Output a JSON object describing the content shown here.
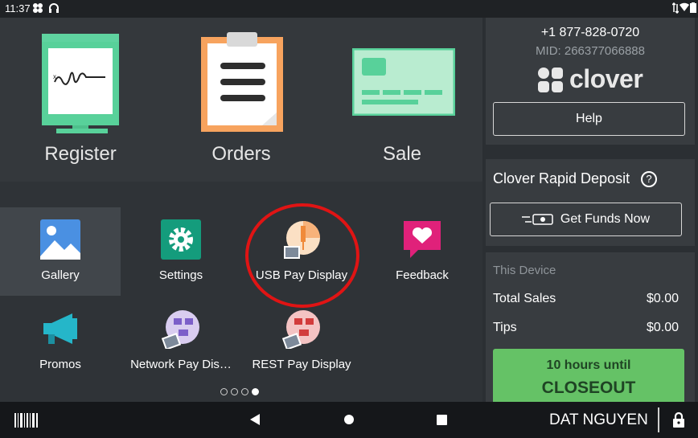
{
  "status_bar": {
    "time": "11:37",
    "icons": [
      "notification-icon",
      "headset-icon",
      "data-arrows-icon",
      "wifi-icon",
      "battery-icon"
    ]
  },
  "hero_tiles": [
    {
      "label": "Register",
      "icon": "register-icon"
    },
    {
      "label": "Orders",
      "icon": "clipboard-icon"
    },
    {
      "label": "Sale",
      "icon": "card-icon"
    }
  ],
  "apps": [
    {
      "label": "Gallery",
      "icon": "gallery-icon"
    },
    {
      "label": "Settings",
      "icon": "gear-icon"
    },
    {
      "label": "USB Pay Display",
      "icon": "usb-pay-display-icon"
    },
    {
      "label": "Feedback",
      "icon": "feedback-icon"
    },
    {
      "label": "Promos",
      "icon": "megaphone-icon"
    },
    {
      "label": "Network Pay Dis…",
      "icon": "network-pay-display-icon"
    },
    {
      "label": "REST Pay Display",
      "icon": "rest-pay-display-icon"
    }
  ],
  "pager": {
    "pages": 4,
    "current": 4
  },
  "account": {
    "phone": "+1 877-828-0720",
    "mid": "MID: 266377066888",
    "brand": "clover",
    "help_label": "Help"
  },
  "rapid_deposit": {
    "title": "Clover Rapid Deposit",
    "help_glyph": "?",
    "button_label": "Get Funds Now"
  },
  "device": {
    "heading": "This Device",
    "total_sales_label": "Total Sales",
    "total_sales_value": "$0.00",
    "tips_label": "Tips",
    "tips_value": "$0.00",
    "closeout_line1": "10 hours until",
    "closeout_line2": "CLOSEOUT"
  },
  "navbar": {
    "employee": "DAT NGUYEN",
    "icons": [
      "barcode-icon",
      "back-icon",
      "home-icon",
      "recents-icon",
      "lock-icon"
    ]
  },
  "colors": {
    "accent_green": "#65c266",
    "annotation_red": "#e01414",
    "background": "#2f3337"
  }
}
